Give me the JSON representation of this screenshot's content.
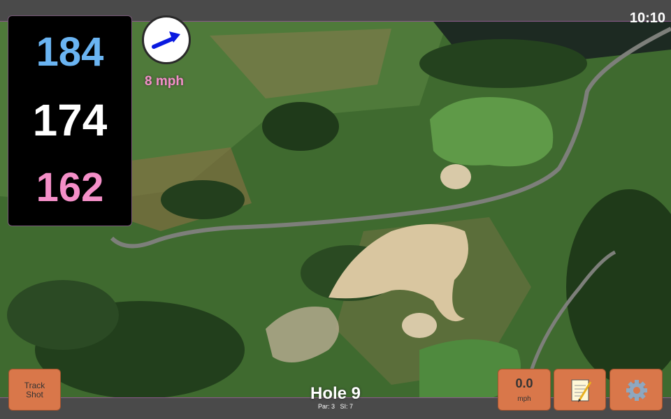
{
  "status_bar": {
    "time": "10:10"
  },
  "distances": {
    "back": "184",
    "middle": "174",
    "front": "162"
  },
  "wind": {
    "speed": "8 mph",
    "direction_icon": "arrow-right-icon"
  },
  "hole": {
    "title": "Hole 9",
    "par_label": "Par: 3",
    "si_label": "SI: 7"
  },
  "buttons": {
    "track_shot_line1": "Track",
    "track_shot_line2": "Shot",
    "speed_value": "0.0",
    "speed_unit": "mph",
    "notes_icon": "notepad-icon",
    "settings_icon": "gear-icon"
  },
  "colors": {
    "back_distance": "#6ab4f2",
    "middle_distance": "#ffffff",
    "front_distance": "#f48fc8",
    "button_bg": "#d9774a",
    "wind_arrow": "#0a1ae0"
  }
}
